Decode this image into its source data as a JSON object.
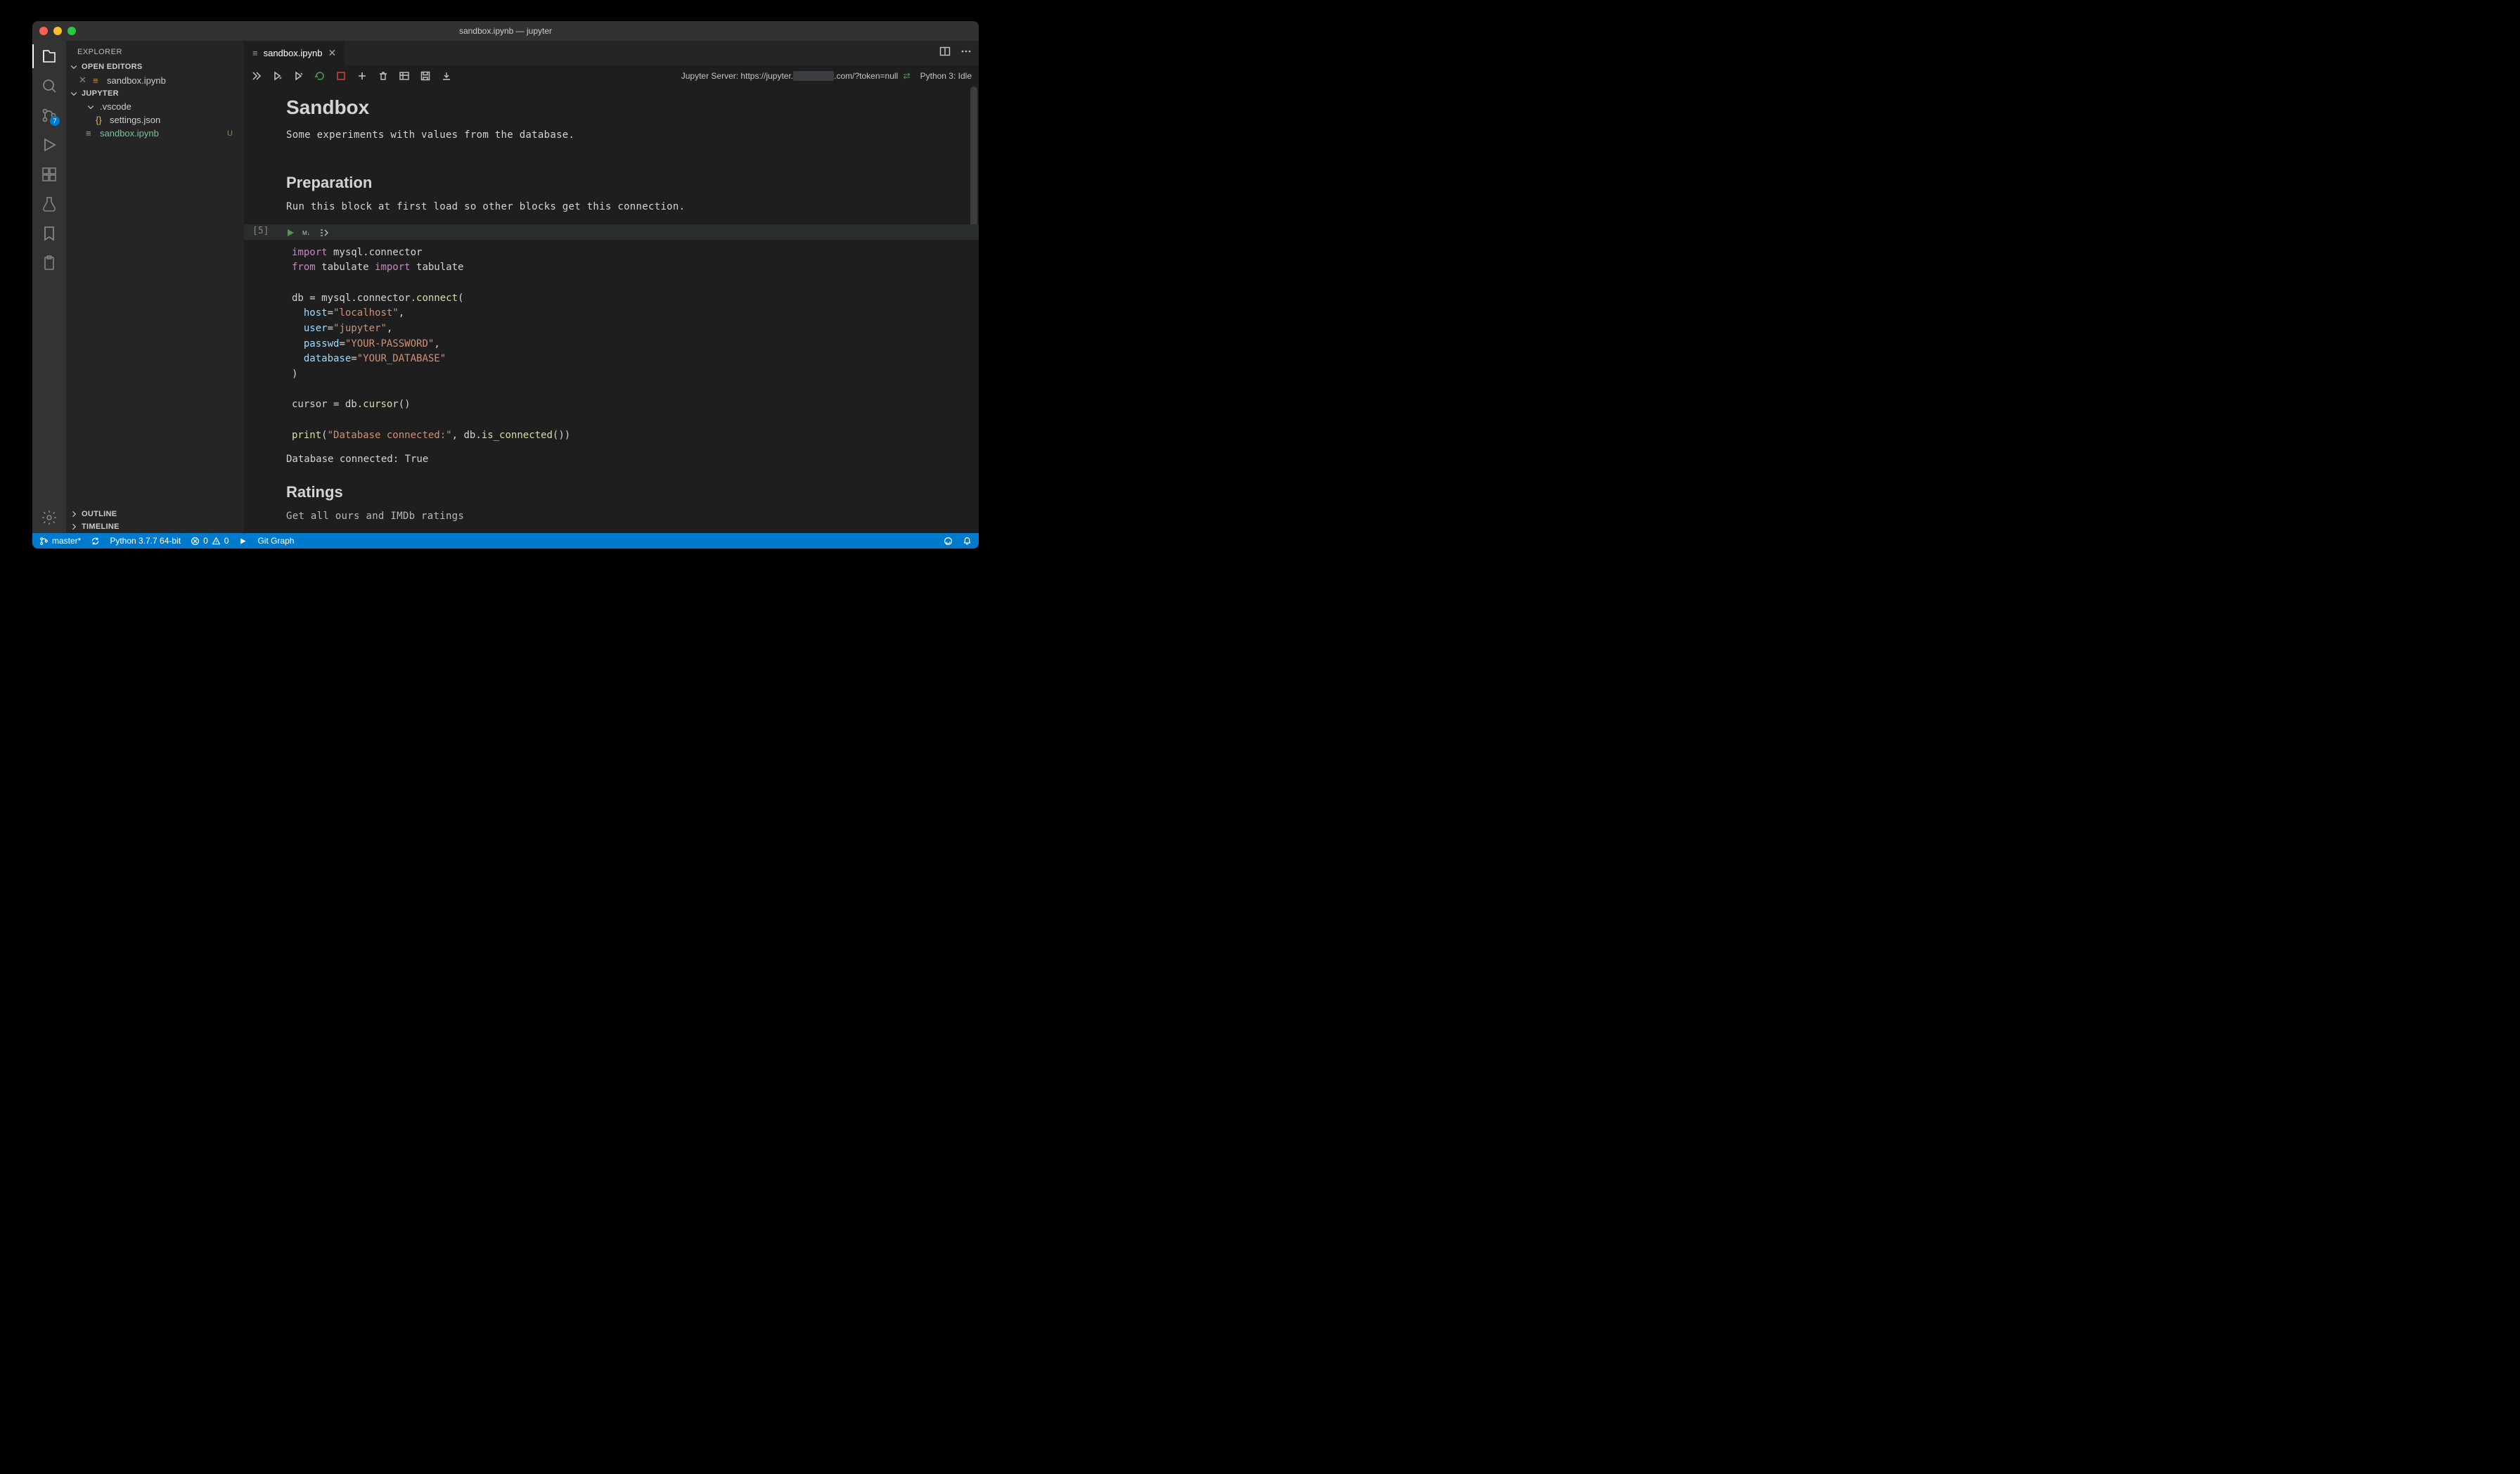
{
  "window": {
    "title": "sandbox.ipynb — jupyter"
  },
  "explorer": {
    "title": "EXPLORER",
    "sections": {
      "open_editors": "OPEN EDITORS",
      "project": "JUPYTER",
      "outline": "OUTLINE",
      "timeline": "TIMELINE"
    },
    "open_files": [
      {
        "name": "sandbox.ipynb"
      }
    ],
    "tree": {
      "vscode_folder": ".vscode",
      "settings_file": "settings.json",
      "notebook_file": "sandbox.ipynb",
      "notebook_tag": "U"
    }
  },
  "scm_badge": "7",
  "tab": {
    "label": "sandbox.ipynb"
  },
  "toolbar_status": {
    "server_label": "Jupyter Server: https://jupyter.",
    "server_suffix": ".com/?token=null",
    "kernel": "Python 3: Idle"
  },
  "notebook": {
    "h1": "Sandbox",
    "p1": "Some experiments with values from the database.",
    "h2a": "Preparation",
    "p2": "Run this block at first load so other blocks get this connection.",
    "cell_prompt": "[5]",
    "code": {
      "l1_kw": "import",
      "l1_rest": " mysql.connector",
      "l2_kw1": "from",
      "l2_mid": " tabulate ",
      "l2_kw2": "import",
      "l2_rest": " tabulate",
      "l4_a": "db = mysql.connector.",
      "l4_fn": "connect",
      "l4_b": "(",
      "l5_arg": "host",
      "l5_eq": "=",
      "l5_str": "\"localhost\"",
      "l5_c": ",",
      "l6_arg": "user",
      "l6_eq": "=",
      "l6_str": "\"jupyter\"",
      "l6_c": ",",
      "l7_arg": "passwd",
      "l7_eq": "=",
      "l7_str": "\"YOUR-PASSWORD\"",
      "l7_c": ",",
      "l8_arg": "database",
      "l8_eq": "=",
      "l8_str": "\"YOUR_DATABASE\"",
      "l9": ")",
      "l11_a": "cursor = db.",
      "l11_fn": "cursor",
      "l11_b": "()",
      "l13_fn": "print",
      "l13_a": "(",
      "l13_str": "\"Database connected:\"",
      "l13_b": ", db.",
      "l13_fn2": "is_connected",
      "l13_c": "())"
    },
    "output": "Database connected: True",
    "h2b": "Ratings",
    "p3": "Get all ours and IMDb ratings"
  },
  "statusbar": {
    "branch": "master*",
    "python": "Python 3.7.7 64-bit",
    "errors": "0",
    "warnings": "0",
    "gitgraph": "Git Graph"
  }
}
